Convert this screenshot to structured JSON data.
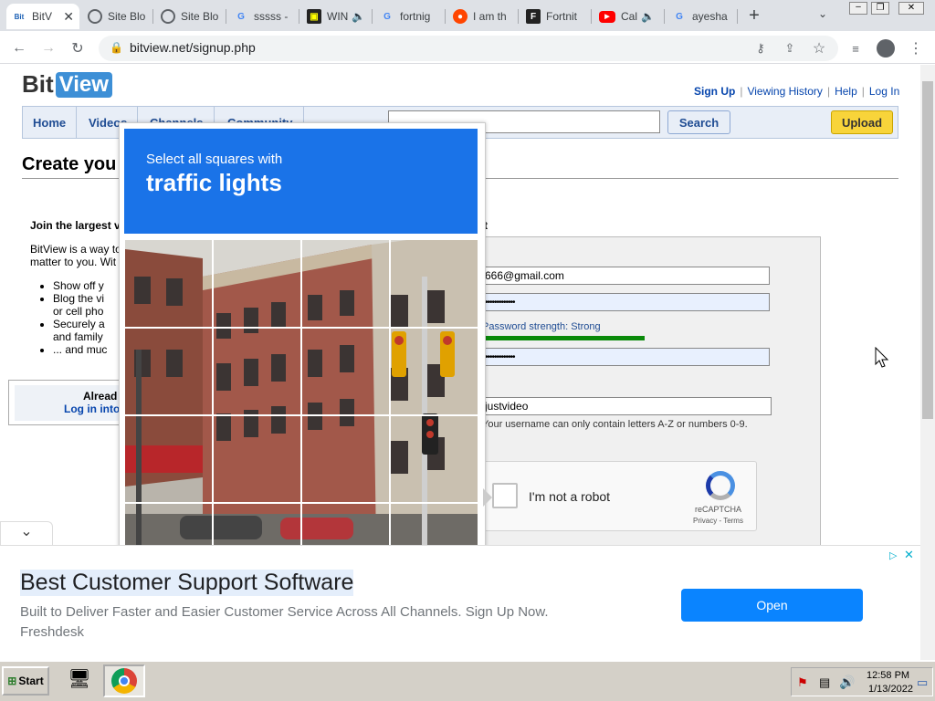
{
  "tabs": [
    {
      "title": "BitV",
      "active": true,
      "icon": "bitview-icon"
    },
    {
      "title": "Site Blo",
      "icon": "globe-icon"
    },
    {
      "title": "Site Blo",
      "icon": "globe-icon"
    },
    {
      "title": "sssss -",
      "icon": "google-icon"
    },
    {
      "title": "WIN",
      "icon": "app-icon",
      "audio": true
    },
    {
      "title": "fortnig",
      "icon": "google-icon"
    },
    {
      "title": "I am th",
      "icon": "reddit-icon"
    },
    {
      "title": "Fortnit",
      "icon": "fortnite-icon"
    },
    {
      "title": "Cal",
      "icon": "youtube-icon",
      "audio": true
    },
    {
      "title": "ayesha",
      "icon": "google-icon"
    }
  ],
  "browser": {
    "url": "bitview.net/signup.php",
    "new_tab": "+"
  },
  "site": {
    "logo_bit": "Bit",
    "logo_view": "View",
    "top_links": [
      "Sign Up",
      "Viewing History",
      "Help",
      "Log In"
    ],
    "nav": [
      "Home",
      "Videos",
      "Channels",
      "Community"
    ],
    "search_button": "Search",
    "upload_button": "Upload",
    "heading": "Create you",
    "join_heading": "Join the largest v",
    "intro": [
      "BitView is a way to",
      "matter to you. Wit"
    ],
    "bullets": [
      "Show off y",
      "Blog the vi",
      "or cell pho",
      "Securely a",
      "and family",
      "... and muc"
    ],
    "already": "Alread",
    "login_link": "Log in into",
    "right_heading_end": "t",
    "email_value": "666@gmail.com",
    "password_dots": "•••••••••••••",
    "strength_label": "Password strength: Strong",
    "strength_level": 0.6,
    "confirm_dots": "•••••••••••••",
    "username_value": "justvideo",
    "username_hint": "Your username can only contain letters A-Z or numbers 0-9.",
    "recaptcha": {
      "checkbox_label": "I'm not a robot",
      "brand": "reCAPTCHA",
      "links": "Privacy - Terms"
    }
  },
  "captcha": {
    "line1": "Select all squares with",
    "line2": "traffic lights"
  },
  "ad": {
    "title": "Best Customer Support Software",
    "text": "Built to Deliver Faster and Easier Customer Service Across All Channels. Sign Up Now.",
    "brand": "Freshdesk",
    "button": "Open"
  },
  "taskbar": {
    "start": "Start",
    "time": "12:58 PM",
    "date": "1/13/2022"
  },
  "colors": {
    "captcha_blue": "#1a73e8",
    "nav_text": "#1f4c93",
    "upload_yellow": "#f8d43a",
    "open_button": "#0a84ff",
    "strength_green": "#0a8a0a"
  }
}
